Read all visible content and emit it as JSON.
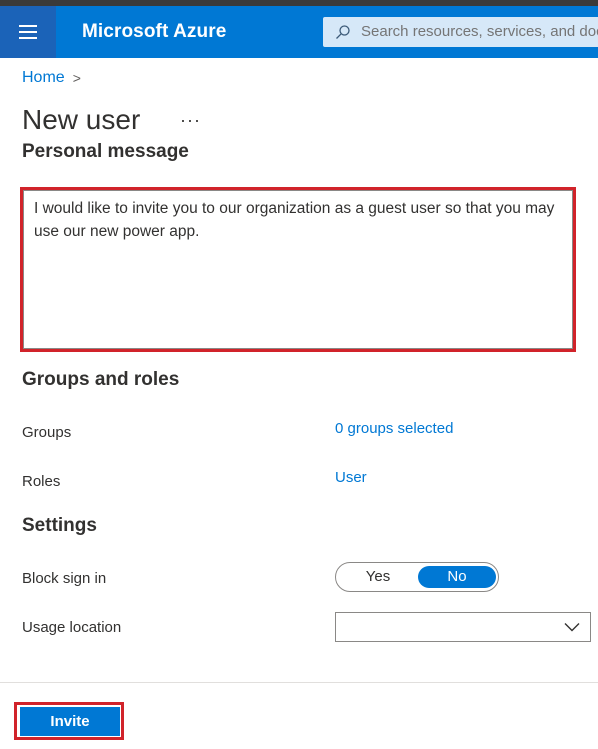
{
  "header": {
    "brand": "Microsoft Azure",
    "search_placeholder": "Search resources, services, and docs (G+/)",
    "accent_color": "#0078d4",
    "icons": [
      "hamburger-menu-icon",
      "search-icon"
    ]
  },
  "breadcrumb": {
    "home": "Home",
    "separator": ">"
  },
  "page": {
    "title": "New user",
    "more": "···"
  },
  "personal_message": {
    "heading": "Personal message",
    "text": "I would like to invite you to our organization as a guest user so that you may use our new power app."
  },
  "groups_and_roles": {
    "heading": "Groups and roles",
    "groups_label": "Groups",
    "groups_value": "0 groups selected",
    "roles_label": "Roles",
    "roles_value": "User"
  },
  "settings": {
    "heading": "Settings",
    "block_sign_in_label": "Block sign in",
    "block_sign_in_options": [
      "Yes",
      "No"
    ],
    "block_sign_in_selected": "No",
    "usage_location_label": "Usage location",
    "usage_location_value": ""
  },
  "footer": {
    "invite_label": "Invite"
  }
}
